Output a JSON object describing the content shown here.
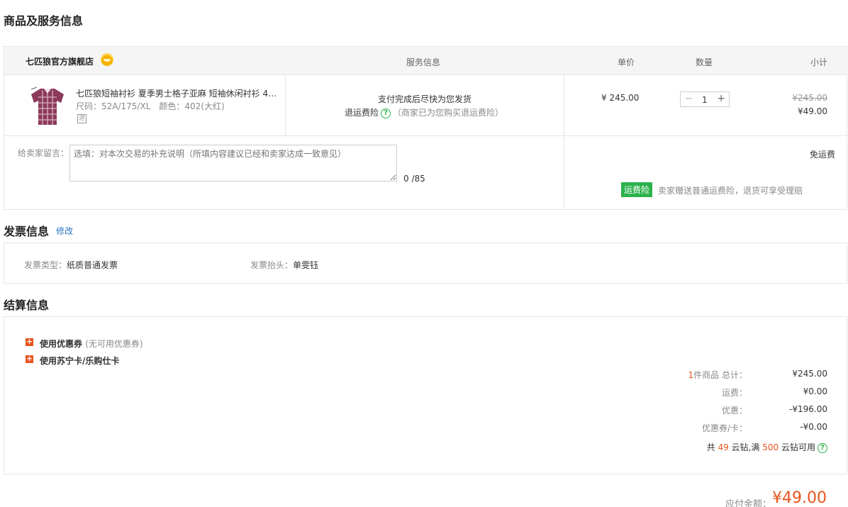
{
  "section_goods": "商品及服务信息",
  "table_head": {
    "shop": "七匹狼官方旗舰店",
    "service": "服务信息",
    "unit_price": "单价",
    "quantity": "数量",
    "subtotal": "小计"
  },
  "item": {
    "title": "七匹狼短袖衬衫 夏季男士格子亚麻 短袖休闲衬衫 4…",
    "size": "尺码：52A/175/XL",
    "color": "颜色：402(大红)",
    "return_badge": "退",
    "service_line1": "支付完成后尽快为您发货",
    "service_line2_label": "退运费险",
    "service_line2_note": "（商家已为您购买退运费险）",
    "price": "¥ 245.00",
    "qty": "1",
    "qty_minus": "−",
    "qty_plus": "+",
    "subtotal_original": "¥245.00",
    "subtotal_final": "¥49.00"
  },
  "message": {
    "label": "给卖家留言：",
    "placeholder": "选填：对本次交易的补充说明（所填内容建议已经和卖家达成一致意见）",
    "count": "0 /85",
    "shipping": "免运费",
    "insurance_badge": "运费险",
    "insurance_text": "卖家赠送普通运费险，退货可享受理赔"
  },
  "invoice": {
    "title": "发票信息",
    "edit": "修改",
    "type_label": "发票类型：",
    "type_value": "纸质普通发票",
    "header_label": "发票抬头：",
    "header_value": "单雯钰"
  },
  "settlement": {
    "title": "结算信息",
    "coupon_label": "使用优惠券",
    "coupon_note": "(无可用优惠券)",
    "card_label": "使用苏宁卡/乐购仕卡",
    "count_prefix": "1",
    "count_label": "件商品 总计：",
    "total_value": "¥245.00",
    "shipping_label": "运费：",
    "shipping_value": "¥0.00",
    "discount_label": "优惠：",
    "discount_value": "-¥196.00",
    "coupon_card_label": "优惠券/卡：",
    "coupon_card_value": "-¥0.00",
    "diamond_prefix": "共",
    "diamond_count": "49",
    "diamond_mid": "云钻,满",
    "diamond_threshold": "500",
    "diamond_suffix": "云钻可用",
    "help_icon": "?"
  },
  "payment": {
    "label": "应付金额：",
    "value": "¥49.00"
  },
  "colors": {
    "accent": "#e8541e",
    "green": "#2bb24c",
    "link": "#2d75c4"
  }
}
